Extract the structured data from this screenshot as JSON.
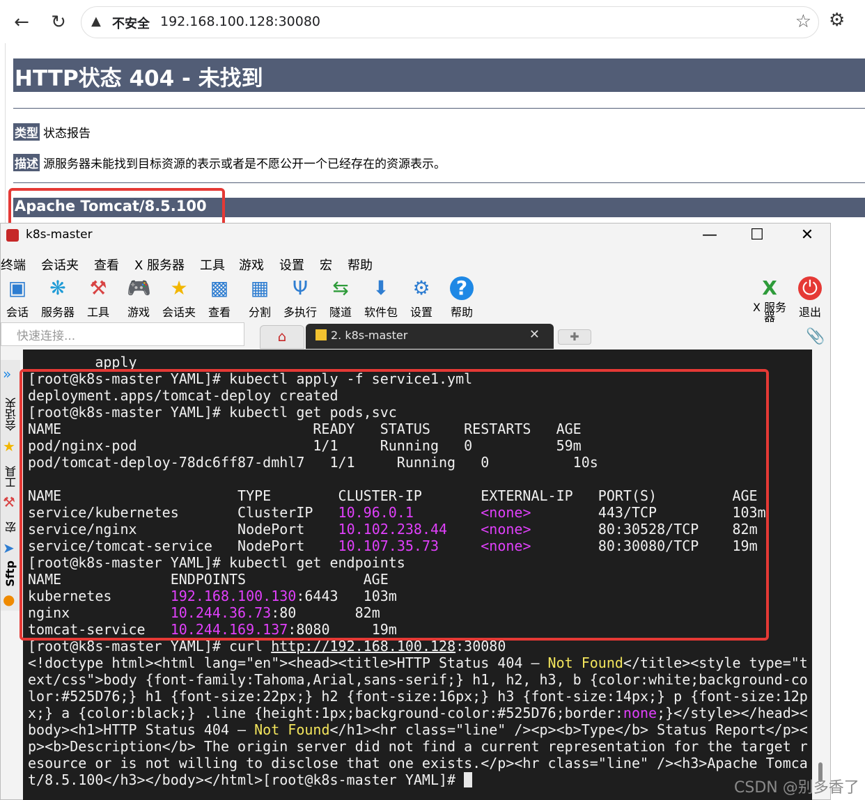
{
  "browser": {
    "insecure_label": "不安全",
    "url": "192.168.100.128:30080"
  },
  "tomcat_page": {
    "h1": "HTTP状态 404 - 未找到",
    "type_label": "类型",
    "type_value": "状态报告",
    "desc_label": "描述",
    "desc_value": "源服务器未能找到目标资源的表示或者是不愿公开一个已经存在的资源表示。",
    "footer": "Apache Tomcat/8.5.100"
  },
  "moba": {
    "window_title": "k8s-master",
    "menu": [
      "终端",
      "会话夹",
      "查看",
      "X 服务器",
      "工具",
      "游戏",
      "设置",
      "宏",
      "帮助"
    ],
    "toolbar": [
      {
        "label": "会话",
        "icon": "monitor-icon"
      },
      {
        "label": "服务器",
        "icon": "servers-icon"
      },
      {
        "label": "工具",
        "icon": "tools-icon"
      },
      {
        "label": "游戏",
        "icon": "gamepad-icon"
      },
      {
        "label": "会话夹",
        "icon": "star-icon"
      },
      {
        "label": "查看",
        "icon": "view-icon"
      },
      {
        "label": "分割",
        "icon": "split-icon"
      },
      {
        "label": "多执行",
        "icon": "fork-icon"
      },
      {
        "label": "隧道",
        "icon": "tunnel-icon"
      },
      {
        "label": "软件包",
        "icon": "package-icon"
      },
      {
        "label": "设置",
        "icon": "gear-icon"
      },
      {
        "label": "帮助",
        "icon": "help-icon"
      }
    ],
    "xserver_label": "X 服务器",
    "exit_label": "退出",
    "quick_connect_placeholder": "快速连接...",
    "tab_label": "2. k8s-master",
    "sidebar": [
      "会话夹",
      "工具",
      "宏",
      "Sftp"
    ]
  },
  "colors": {
    "tomcat_header": "#525D76",
    "terminal_bg": "#1e1e1e",
    "highlight_magenta": "#e040fb",
    "highlight_yellow": "#f3e55c",
    "annotation_red": "#e53935"
  },
  "watermark": "CSDN @别多香了"
}
